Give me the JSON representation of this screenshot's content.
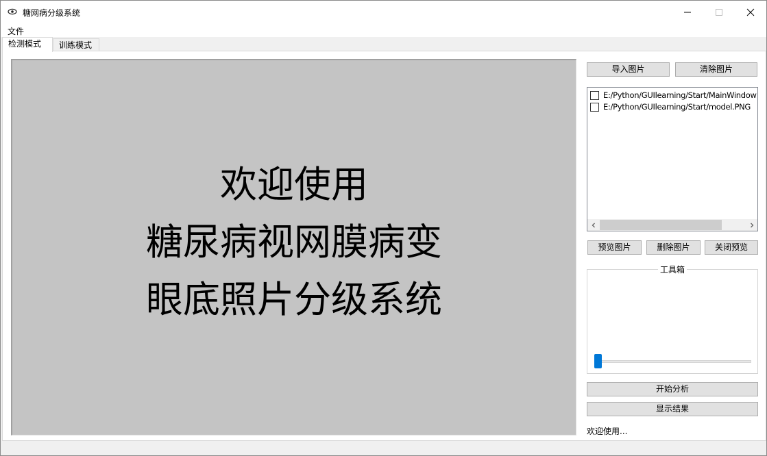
{
  "window": {
    "title": "糖网病分级系统",
    "icon": "eye-icon"
  },
  "menu": {
    "file_label": "文件"
  },
  "tabs": [
    {
      "label": "检测模式",
      "active": true
    },
    {
      "label": "训练模式",
      "active": false
    }
  ],
  "image_panel": {
    "welcome_lines": [
      "欢迎使用",
      "糖尿病视网膜病变",
      "眼底照片分级系统"
    ]
  },
  "buttons": {
    "import": "导入图片",
    "clear": "清除图片",
    "preview": "预览图片",
    "delete": "删除图片",
    "close_preview": "关闭预览",
    "analyze": "开始分析",
    "results": "显示结果"
  },
  "file_list": {
    "items": [
      {
        "path": "E:/Python/GUIlearning/Start/MainWindow",
        "checked": false
      },
      {
        "path": "E:/Python/GUIlearning/Start/model.PNG",
        "checked": false
      }
    ]
  },
  "toolbox": {
    "title": "工具箱",
    "slider_value": 0
  },
  "status": {
    "message": "欢迎使用..."
  },
  "colors": {
    "slider_accent": "#0078d7",
    "image_panel_bg": "#c4c4c4",
    "button_bg": "#e1e1e1"
  }
}
